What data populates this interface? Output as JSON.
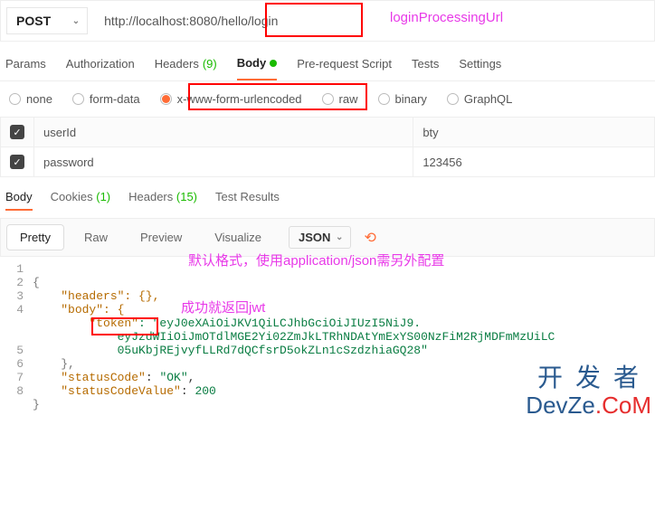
{
  "request": {
    "method": "POST",
    "url": "http://localhost:8080/hello/login"
  },
  "annotations": {
    "loginProcUrl": "loginProcessingUrl",
    "formatNote": "默认格式，使用application/json需另外配置",
    "successNote": "成功就返回jwt"
  },
  "tabs": {
    "params": "Params",
    "auth": "Authorization",
    "headers": "Headers",
    "headersCount": "(9)",
    "body": "Body",
    "preReq": "Pre-request Script",
    "tests": "Tests",
    "settings": "Settings"
  },
  "bodyTypes": {
    "none": "none",
    "formdata": "form-data",
    "xwww": "x-www-form-urlencoded",
    "raw": "raw",
    "binary": "binary",
    "graphql": "GraphQL"
  },
  "params": [
    {
      "enabled": true,
      "key": "userId",
      "value": "bty"
    },
    {
      "enabled": true,
      "key": "password",
      "value": "123456"
    }
  ],
  "respTabs": {
    "body": "Body",
    "cookies": "Cookies",
    "cookiesCount": "(1)",
    "headers": "Headers",
    "headersCount": "(15)",
    "testres": "Test Results"
  },
  "viewModes": {
    "pretty": "Pretty",
    "raw": "Raw",
    "preview": "Preview",
    "visual": "Visualize",
    "lang": "JSON"
  },
  "responseJson": {
    "l2": "\"headers\": {},",
    "l3": "\"body\": {",
    "l4key": "\"token\"",
    "l4a": ": \"eyJ0eXAiOiJKV1QiLCJhbGciOiJIUzI5NiJ9.",
    "l4b": "eyJzdWIiOiJmOTdlMGE2Yi02ZmJkLTRhNDAtYmExYS00NzFiM2RjMDFmMzUiLC",
    "l4c": "05uKbjREjvyfLLRd7dQCfsrD5okZLn1cSzdzhiaGQ28\"",
    "l5": "},",
    "l6k": "\"statusCode\"",
    "l6v": "\"OK\"",
    "l7k": "\"statusCodeValue\"",
    "l7v": "200"
  },
  "watermark": {
    "line1": "开发者",
    "line2a": "DevZe",
    "line2b": ".CoM"
  }
}
